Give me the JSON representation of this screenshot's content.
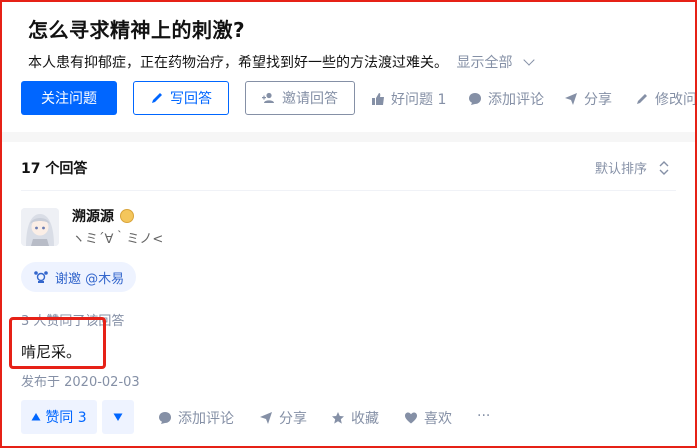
{
  "question": {
    "title": "怎么寻求精神上的刺激?",
    "description": "本人患有抑郁症，正在药物治疗，希望找到好一些的方法渡过难关。",
    "show_all": "显示全部"
  },
  "question_actions": {
    "follow": "关注问题",
    "write_answer": "写回答",
    "invite_answer": "邀请回答",
    "good_question": "好问题 1",
    "add_comment": "添加评论",
    "share": "分享",
    "edit": "修改问"
  },
  "answers_header": {
    "count": "17 个回答",
    "sort": "默认排序"
  },
  "answer": {
    "author_name": "溯源源",
    "author_bio": "ヽミ´∀｀ミノ<",
    "invite_chip": "谢邀 @木易",
    "likes_line": "3 人赞同了该回答",
    "content": "啃尼采。",
    "date": "发布于 2020-02-03",
    "vote_up": "赞同 3"
  },
  "answer_actions": {
    "add_comment": "添加评论",
    "share": "分享",
    "collect": "收藏",
    "like": "喜欢",
    "more": "···"
  },
  "colors": {
    "brand_blue": "#0066ff",
    "muted_gray": "#8590a6",
    "highlight_red": "#e62117"
  }
}
